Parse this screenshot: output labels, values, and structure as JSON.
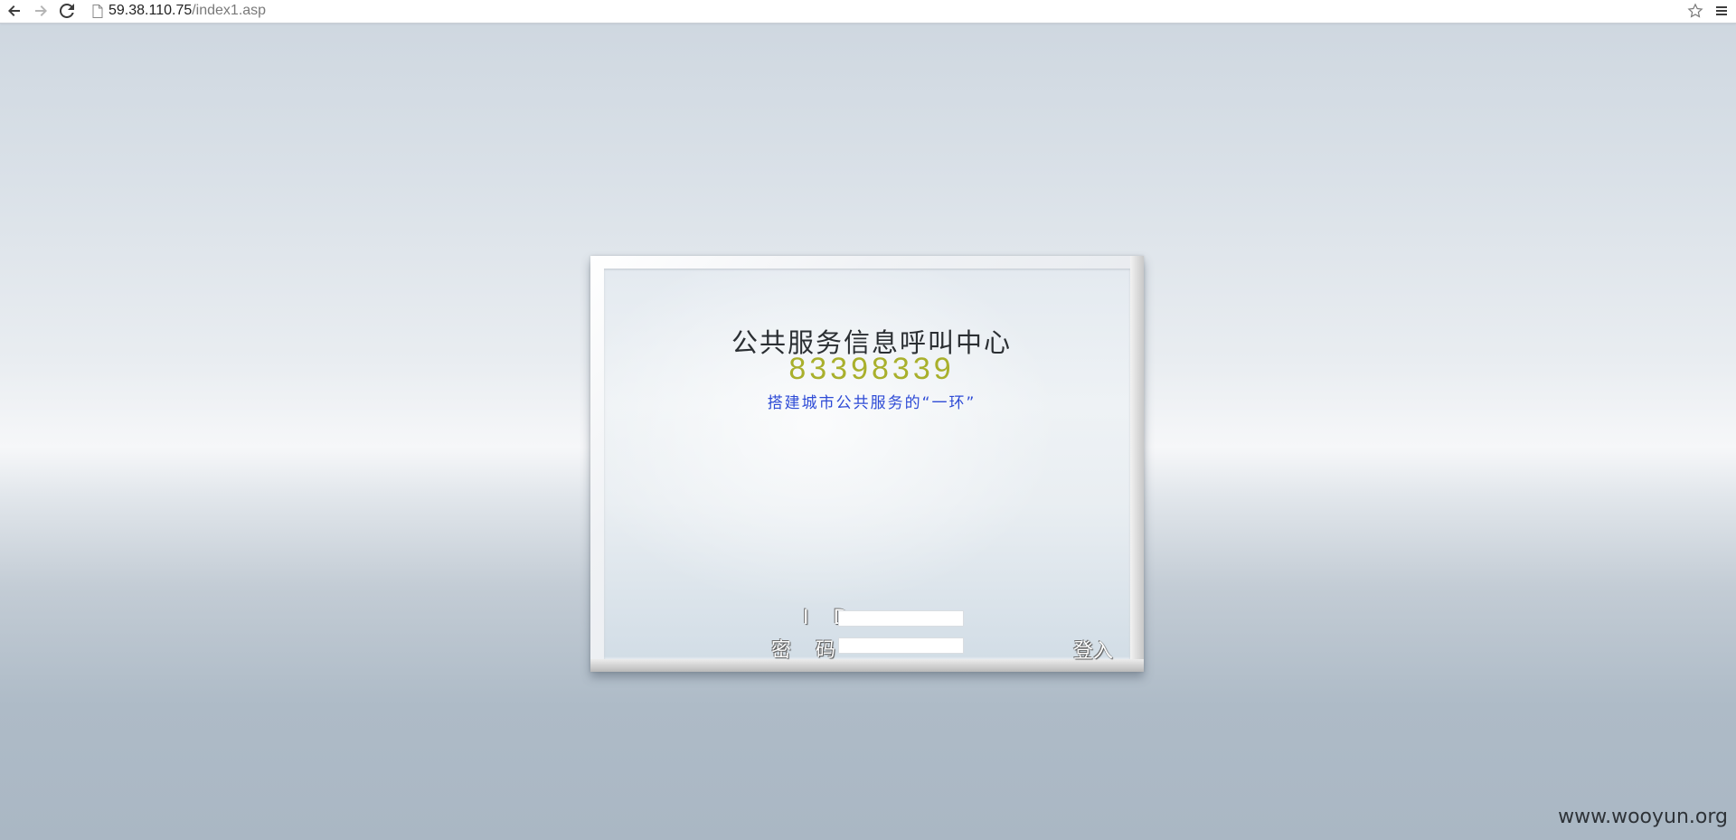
{
  "browser": {
    "url_host": "59.38.110.75",
    "url_path": "/index1.asp",
    "icons": {
      "back": "arrow-left-icon",
      "forward": "arrow-right-icon",
      "reload": "reload-icon",
      "page": "page-icon",
      "bookmark": "star-icon",
      "menu": "hamburger-menu-icon"
    }
  },
  "login": {
    "title": "公共服务信息呼叫中心",
    "phone": "83398339",
    "slogan": "搭建城市公共服务的“一环”",
    "id_label": "I D",
    "password_label": "密 码",
    "id_value": "",
    "password_value": "",
    "submit_label": "登入"
  },
  "watermark": "www.wooyun.org",
  "colors": {
    "phone": "#a9b02c",
    "slogan": "#2e4bd6",
    "title": "#2b2f33"
  }
}
